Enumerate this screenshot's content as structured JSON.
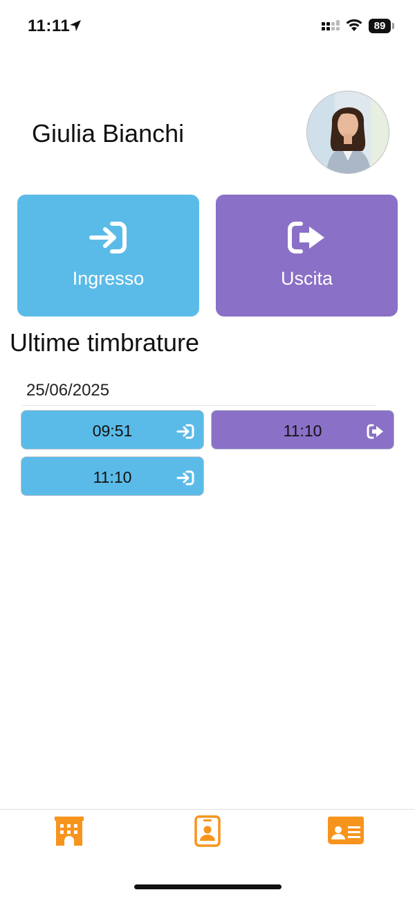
{
  "status_bar": {
    "time": "11:11",
    "battery": "89"
  },
  "header": {
    "user_name": "Giulia Bianchi",
    "avatar_icon": "user-photo"
  },
  "actions": {
    "check_in_label": "Ingresso",
    "check_out_label": "Uscita",
    "check_in_icon": "sign-in-icon",
    "check_out_icon": "sign-out-icon"
  },
  "section": {
    "title": "Ultime timbrature"
  },
  "records": {
    "date": "25/06/2025",
    "entries": [
      {
        "time": "09:51",
        "type": "in"
      },
      {
        "time": "11:10",
        "type": "out"
      },
      {
        "time": "11:10",
        "type": "in"
      }
    ]
  },
  "tab_bar": {
    "tabs": [
      {
        "icon": "building-icon"
      },
      {
        "icon": "badge-icon"
      },
      {
        "icon": "id-card-icon"
      }
    ]
  },
  "colors": {
    "check_in": "#5bbbe8",
    "check_out": "#8a70c6",
    "tab_icon": "#f7941d"
  }
}
